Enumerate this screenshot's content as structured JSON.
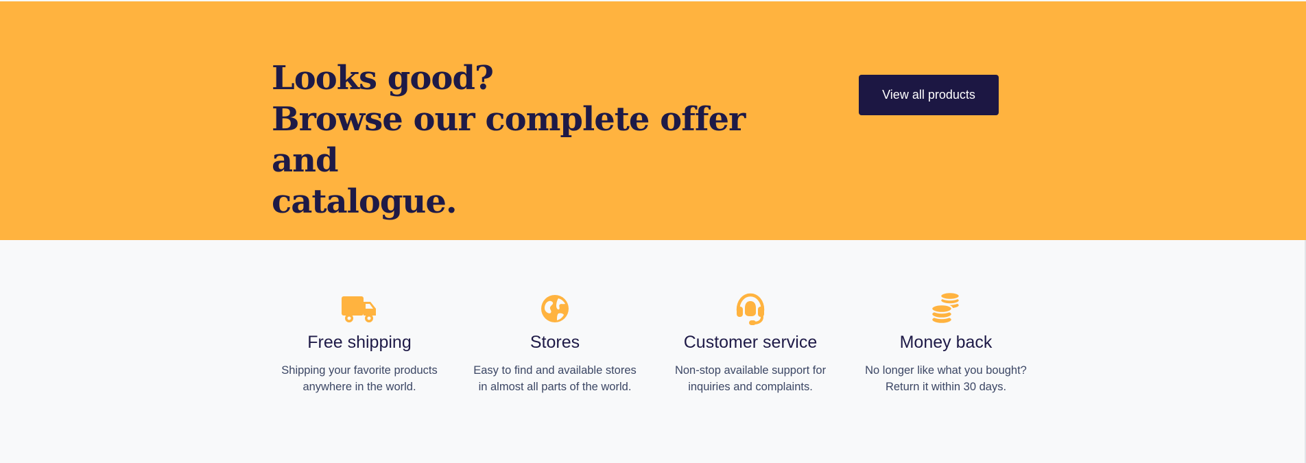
{
  "colors": {
    "banner_background": "#ffb33f",
    "heading_text": "#1e1a47",
    "button_background": "#1c1743",
    "button_text": "#ffffff",
    "section_background": "#f8f9fa",
    "icon_accent": "#ffb33f",
    "body_text": "#3b4664"
  },
  "cta": {
    "heading_line_1": "Looks good?",
    "heading_line_2": "Browse our complete offer and",
    "heading_line_3": "catalogue.",
    "button_label": "View all products"
  },
  "features": [
    {
      "icon": "truck-icon",
      "title": "Free shipping",
      "desc_line_1": "Shipping your favorite products",
      "desc_line_2": "anywhere in the world."
    },
    {
      "icon": "globe-icon",
      "title": "Stores",
      "desc_line_1": "Easy to find and available stores",
      "desc_line_2": "in almost all parts of the world."
    },
    {
      "icon": "headset-icon",
      "title": "Customer service",
      "desc_line_1": "Non-stop available support for",
      "desc_line_2": "inquiries and complaints."
    },
    {
      "icon": "coins-icon",
      "title": "Money back",
      "desc_line_1": "No longer like what you bought?",
      "desc_line_2": "Return it within 30 days."
    }
  ]
}
